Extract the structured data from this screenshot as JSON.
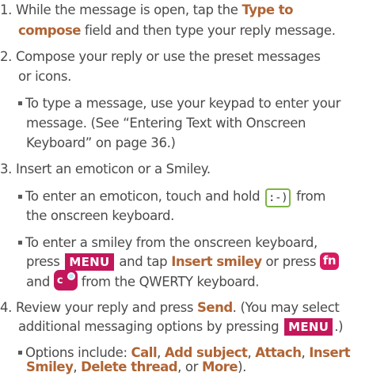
{
  "steps": [
    {
      "num": "1.",
      "line1_pre": "While the message is open, tap the ",
      "line1_bold": "Type to",
      "line2_bold": "compose",
      "line2_post": " field and then type your reply message."
    },
    {
      "num": "2.",
      "line1": "Compose your reply or use the preset messages",
      "line2": "or icons.",
      "bullet": {
        "line1": "To type a message, use your keypad to enter your",
        "line2": "message. (See “Entering Text with Onscreen",
        "line3": "Keyboard” on page 36.)"
      }
    },
    {
      "num": "3.",
      "line1": "Insert an emoticon or a Smiley.",
      "bullet1": {
        "line1_pre": "To enter an emoticon, touch and hold ",
        "key": ":-)",
        "line1_post": " from",
        "line2": "the onscreen keyboard."
      },
      "bullet2": {
        "line1": "To enter a smiley from the onscreen keyboard,",
        "line2_pre": "press ",
        "line2_key": "MENU",
        "line2_mid": " and tap ",
        "line2_bold": "Insert smiley",
        "line2_post": " or press ",
        "fn_key": "fn",
        "line3_pre": "and ",
        "line3_post": " from the QWERTY keyboard."
      }
    },
    {
      "num": "4.",
      "line1_pre": "Review your reply and press ",
      "line1_bold": "Send",
      "line1_post": ". (You may select",
      "line2_pre": "additional messaging options by pressing ",
      "line2_key": "MENU",
      "line2_post": ".)",
      "bullet": {
        "line1_pre": "Options include: ",
        "b1": "Call",
        "s1": ", ",
        "b2": "Add subject",
        "s2": ", ",
        "b3": "Attach",
        "s3": ", ",
        "b4": "Insert",
        "b5": "Smiley",
        "s5": ", ",
        "b6": "Delete thread",
        "s6": ", or ",
        "b7": "More",
        "end": ")."
      }
    }
  ],
  "colors": {
    "text": "#4a4a4a",
    "bold": "#b06434",
    "menu_key": "#c2185b",
    "emoticon_border": "#7fb346"
  }
}
